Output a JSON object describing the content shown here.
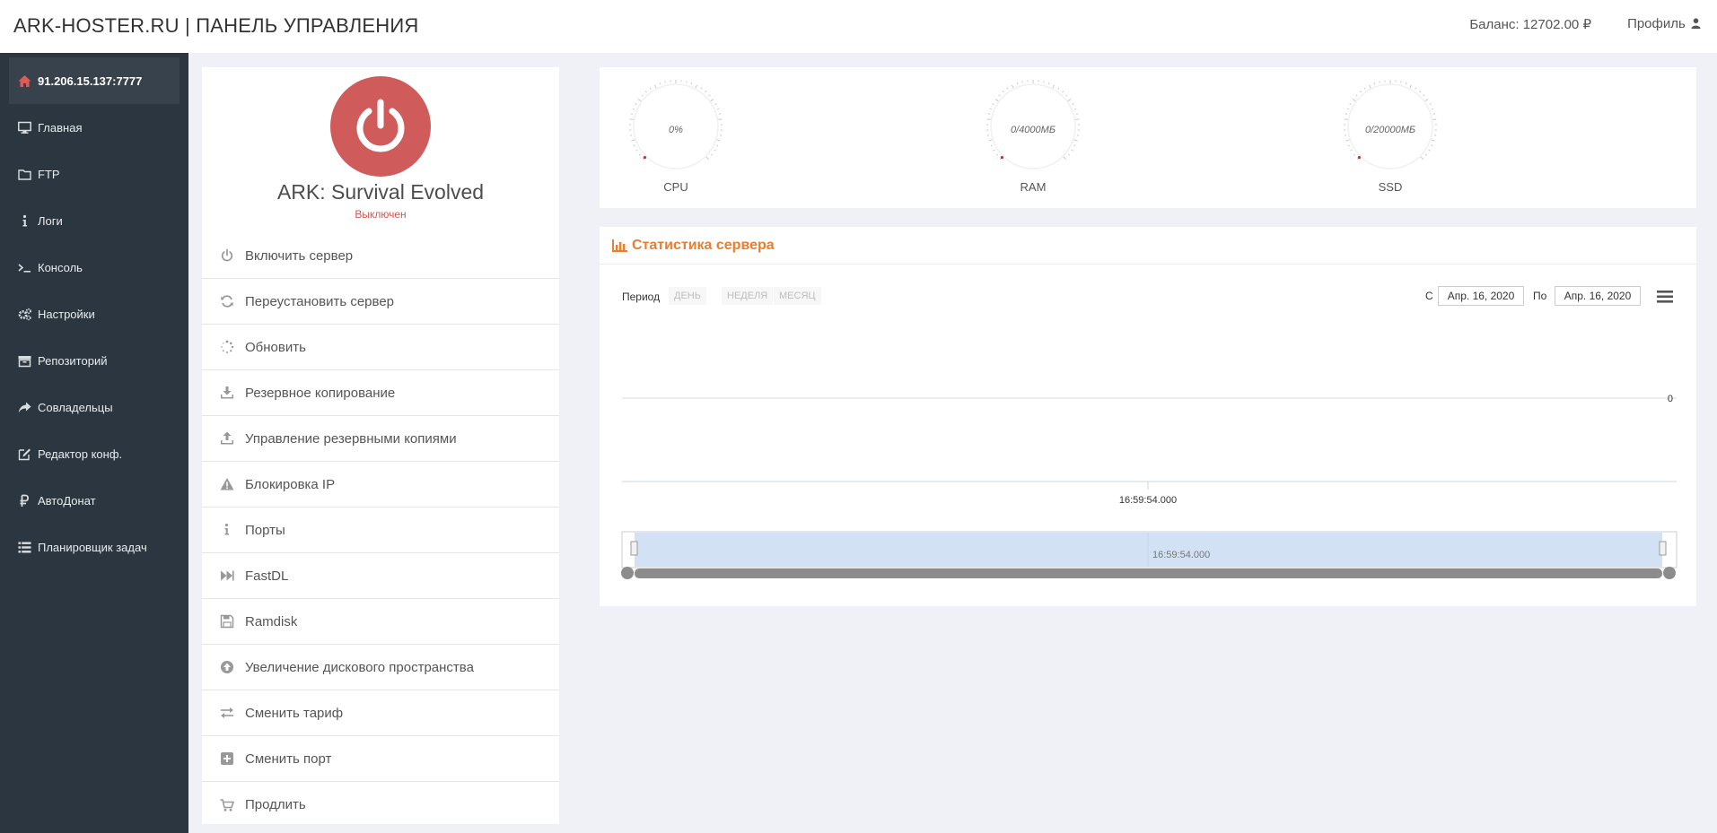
{
  "header": {
    "brand": "ARK-HOSTER.RU | ПАНЕЛЬ УПРАВЛЕНИЯ",
    "balance": "Баланс: 12702.00 ₽",
    "profile": "Профиль"
  },
  "sidebar": {
    "items": [
      {
        "label": "91.206.15.137:7777",
        "icon": "home-icon"
      },
      {
        "label": "Главная",
        "icon": "monitor-icon"
      },
      {
        "label": "FTP",
        "icon": "folder-icon"
      },
      {
        "label": "Логи",
        "icon": "info-icon"
      },
      {
        "label": "Консоль",
        "icon": "terminal-icon"
      },
      {
        "label": "Настройки",
        "icon": "gears-icon"
      },
      {
        "label": "Репозиторий",
        "icon": "archive-icon"
      },
      {
        "label": "Совладельцы",
        "icon": "share-icon"
      },
      {
        "label": "Редактор конф.",
        "icon": "edit-icon"
      },
      {
        "label": "АвтоДонат",
        "icon": "ruble-icon"
      },
      {
        "label": "Планировщик задач",
        "icon": "list-icon"
      }
    ]
  },
  "server": {
    "title": "ARK: Survival Evolved",
    "status": "Выключен",
    "status_color": "#d9534f",
    "power_color": "#cf5b5b"
  },
  "menu": {
    "items": [
      {
        "label": "Включить сервер",
        "icon": "power-icon"
      },
      {
        "label": "Переустановить сервер",
        "icon": "refresh-icon"
      },
      {
        "label": "Обновить",
        "icon": "spinner-icon"
      },
      {
        "label": "Резервное копирование",
        "icon": "download-icon"
      },
      {
        "label": "Управление резервными копиями",
        "icon": "upload-icon"
      },
      {
        "label": "Блокировка IP",
        "icon": "warning-icon"
      },
      {
        "label": "Порты",
        "icon": "info-icon"
      },
      {
        "label": "FastDL",
        "icon": "fast-forward-icon"
      },
      {
        "label": "Ramdisk",
        "icon": "floppy-icon"
      },
      {
        "label": "Увеличение дискового пространства",
        "icon": "arrow-circle-up-icon"
      },
      {
        "label": "Сменить тариф",
        "icon": "exchange-icon"
      },
      {
        "label": "Сменить порт",
        "icon": "plus-square-icon"
      },
      {
        "label": "Продлить",
        "icon": "cart-icon"
      }
    ]
  },
  "gauges": [
    {
      "value": "0%",
      "label": "CPU",
      "level": 0
    },
    {
      "value": "0/4000МБ",
      "label": "RAM",
      "level": 0
    },
    {
      "value": "0/20000МБ",
      "label": "SSD",
      "level": 0
    }
  ],
  "stats": {
    "title": "Статистика сервера",
    "period_label": "Период",
    "periods": [
      "ДЕНЬ",
      "НЕДЕЛЯ",
      "МЕСЯЦ"
    ],
    "from_label": "С",
    "from_date": "Апр. 16, 2020",
    "to_label": "По",
    "to_date": "Апр. 16, 2020",
    "accent": "#e87e2e"
  },
  "chart_data": {
    "type": "line",
    "y_tick_labels": [
      "0"
    ],
    "x_tick_labels": [
      "16:59:54.000"
    ],
    "navigator_label": "16:59:54.000",
    "series": []
  }
}
